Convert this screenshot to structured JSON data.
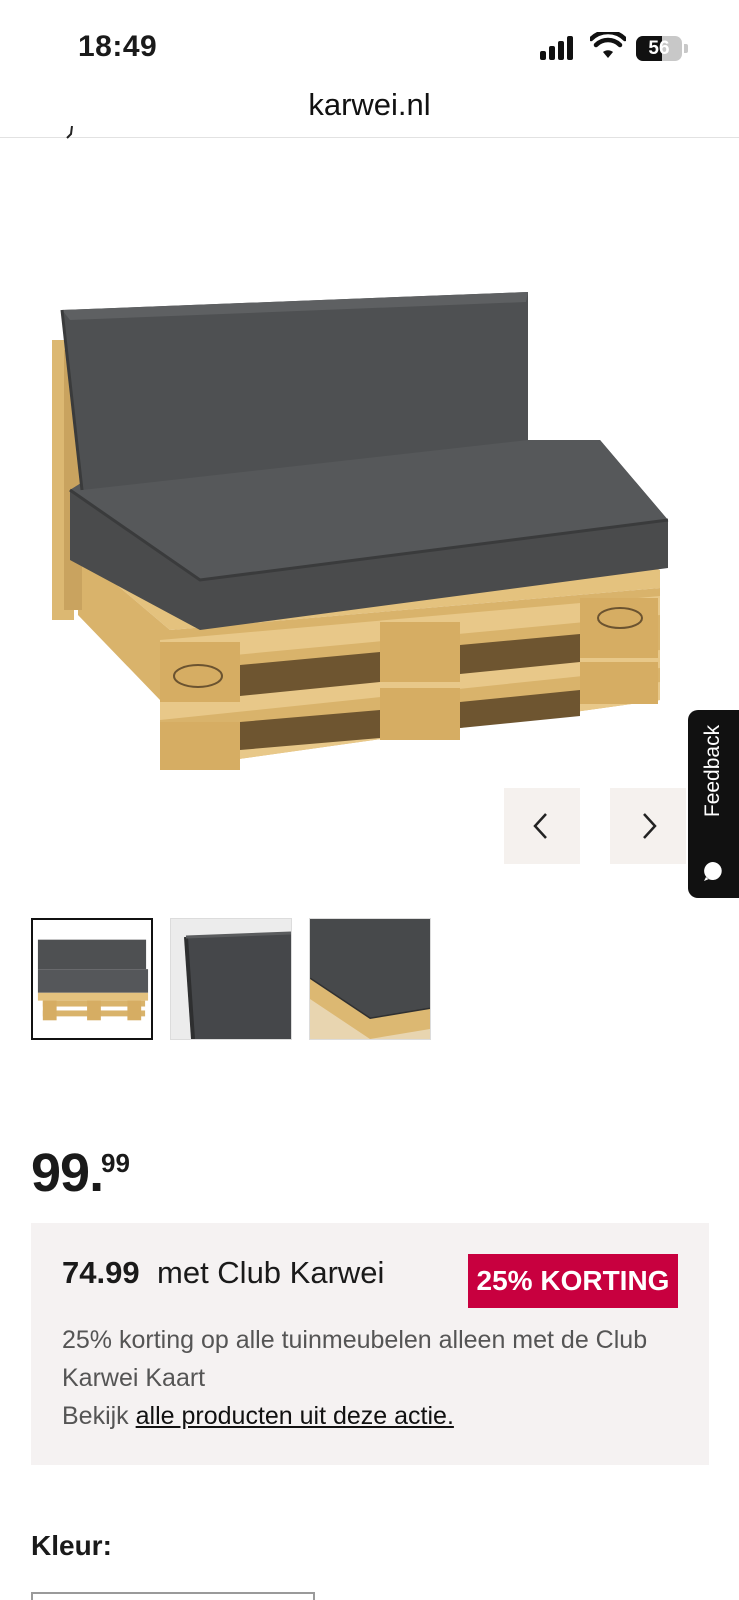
{
  "status_bar": {
    "time": "18:49",
    "battery": "56",
    "battery_level": 0.56
  },
  "browser": {
    "url": "karwei.nl"
  },
  "product": {
    "image_alt": "palletkussen-set antraciet op pallet",
    "carousel_prev_icon": "chevron-left-icon",
    "carousel_next_icon": "chevron-right-icon",
    "thumbnail_count": 3,
    "selected_thumbnail": 1
  },
  "feedback": {
    "label": "Feedback",
    "icon": "chat-bubble-icon"
  },
  "price": {
    "whole": "99.",
    "cents": "99"
  },
  "promo": {
    "club_price": "74.99",
    "club_text": "met Club Karwei",
    "badge": "25% KORTING",
    "description": "25% korting op alle tuinmeubelen alleen met de Club Karwei Kaart",
    "link_prefix": "Bekijk",
    "link_text": "alle producten uit deze actie.",
    "badge_color": "#c8003f",
    "box_color": "#f5f2f2"
  },
  "color_section": {
    "label": "Kleur:"
  }
}
